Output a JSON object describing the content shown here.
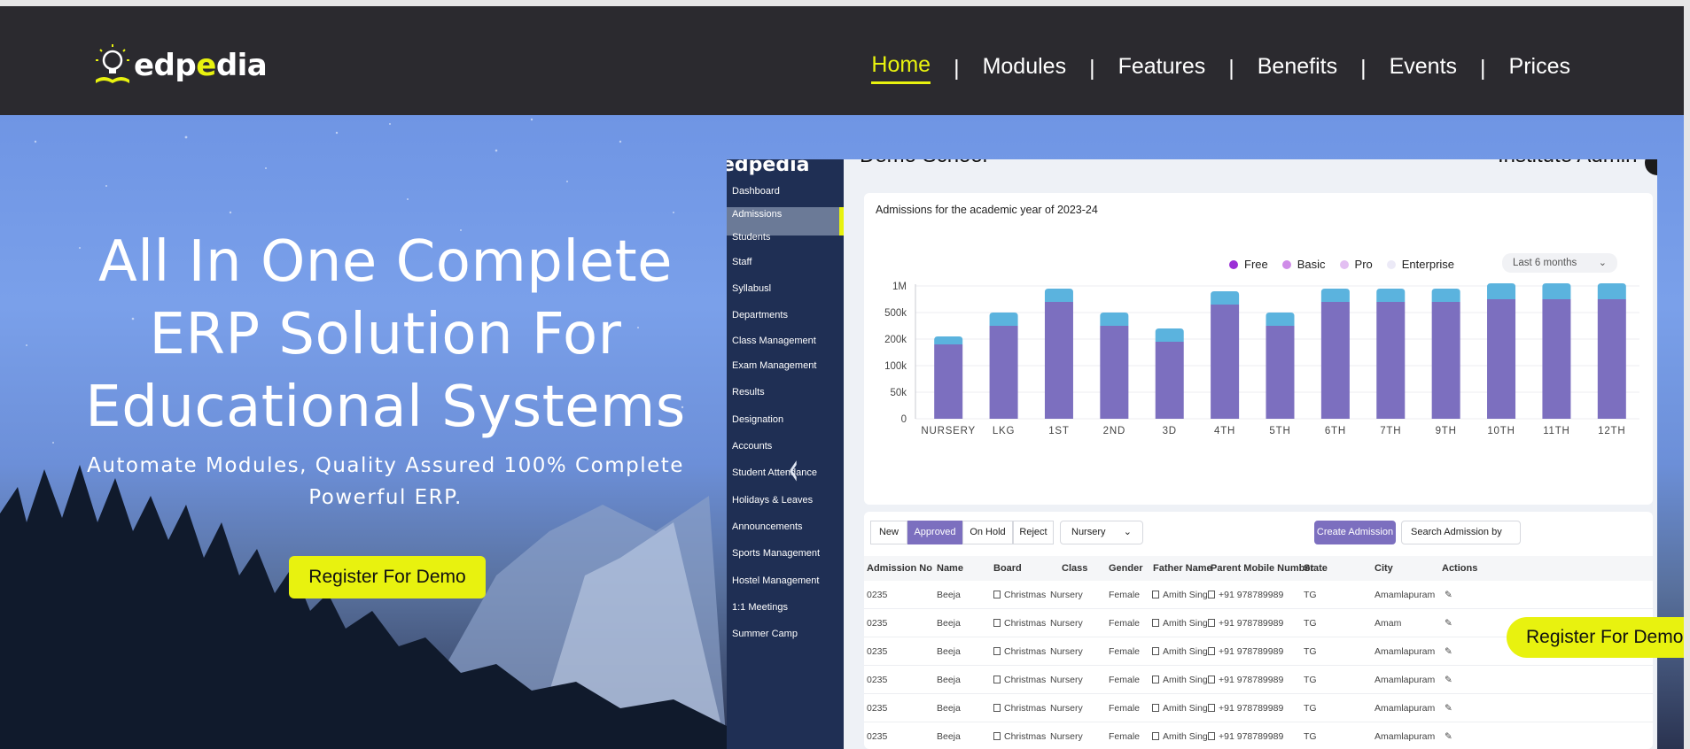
{
  "brand": {
    "name_prefix": "edp",
    "name_accent": "e",
    "name_suffix": "dia"
  },
  "nav": {
    "items": [
      "Home",
      "Modules",
      "Features",
      "Benefits",
      "Events",
      "Prices"
    ],
    "active": "Home",
    "separator": "|"
  },
  "hero": {
    "headline_lines": [
      "All In One Complete",
      "ERP Solution For",
      "Educational Systems"
    ],
    "subline_lines": [
      "Automate Modules, Quality Assured 100% Complete",
      "Powerful ERP."
    ],
    "cta_label": "Register For Demo",
    "floating_cta_label": "Register For Demo"
  },
  "dashboard": {
    "logo_text": "edpedia",
    "school_title": "Demo School",
    "role": "Institute Admin",
    "sidebar": [
      "Dashboard",
      "Admissions",
      "Students",
      "Staff",
      "Syllabusl",
      "Departments",
      "Class Management",
      "Exam Management",
      "Results",
      "Designation",
      "Accounts",
      "Student Attendance",
      "Holidays & Leaves",
      "Announcements",
      "Sports Management",
      "Hostel Management",
      "1:1 Meetings",
      "Summer Camp"
    ],
    "sidebar_active": "Admissions",
    "chart_title": "Admissions for the academic year of 2023-24",
    "period_label": "Last 6 months",
    "table_tabs": [
      "New",
      "Approved",
      "On Hold",
      "Reject"
    ],
    "class_filter": "Nursery",
    "create_label": "Create Admission",
    "search_label": "Search Admission by",
    "columns": [
      "Admission No",
      "Name",
      "Board",
      "Class",
      "Gender",
      "Father Name",
      "Parent Mobile Number",
      "State",
      "City",
      "Actions"
    ],
    "rows": [
      [
        "0235",
        "Beeja",
        "Christmas",
        "Nursery",
        "Female",
        "Amith Sing",
        "+91 978789989",
        "TG",
        "Amamlapuram"
      ],
      [
        "0235",
        "Beeja",
        "Christmas",
        "Nursery",
        "Female",
        "Amith Sing",
        "+91 978789989",
        "TG",
        "Amam"
      ],
      [
        "0235",
        "Beeja",
        "Christmas",
        "Nursery",
        "Female",
        "Amith Sing",
        "+91 978789989",
        "TG",
        "Amamlapuram"
      ],
      [
        "0235",
        "Beeja",
        "Christmas",
        "Nursery",
        "Female",
        "Amith Sing",
        "+91 978789989",
        "TG",
        "Amamlapuram"
      ],
      [
        "0235",
        "Beeja",
        "Christmas",
        "Nursery",
        "Female",
        "Amith Sing",
        "+91 978789989",
        "TG",
        "Amamlapuram"
      ],
      [
        "0235",
        "Beeja",
        "Christmas",
        "Nursery",
        "Female",
        "Amith Sing",
        "+91 978789989",
        "TG",
        "Amamlapuram"
      ]
    ]
  },
  "chart_data": {
    "type": "bar",
    "stacked": true,
    "title": "Admissions for the academic year of 2023-24",
    "categories": [
      "NURSERY",
      "LKG",
      "1ST",
      "2ND",
      "3D",
      "4TH",
      "5TH",
      "6TH",
      "7TH",
      "9TH",
      "10TH",
      "11TH",
      "12TH"
    ],
    "y_ticks": [
      "0",
      "50k",
      "100k",
      "200k",
      "500k",
      "1M"
    ],
    "legend": [
      "Free",
      "Basic",
      "Pro",
      "Enterprise"
    ],
    "legend_position": "top-right",
    "legend_colors": [
      "#9b2fd6",
      "#cf8ce8",
      "#e3bff2",
      "#eceaf7"
    ],
    "series": [
      {
        "name": "Free",
        "color": "#7c6fbf",
        "tick_level": [
          2.8,
          3.5,
          4.4,
          3.5,
          2.9,
          4.3,
          3.5,
          4.4,
          4.4,
          4.4,
          4.5,
          4.5,
          4.5
        ]
      },
      {
        "name": "Basic",
        "color": "#5bb3de",
        "tick_level": [
          0.3,
          0.5,
          0.5,
          0.5,
          0.5,
          0.5,
          0.5,
          0.5,
          0.5,
          0.5,
          0.6,
          0.6,
          0.6
        ]
      }
    ],
    "grid": true
  },
  "colors": {
    "nav_bg": "#2b2a2f",
    "accent": "#e8f20f",
    "sidebar_bg": "#1f2f54",
    "bar_primary": "#7c6fbf",
    "bar_top": "#5bb3de"
  }
}
